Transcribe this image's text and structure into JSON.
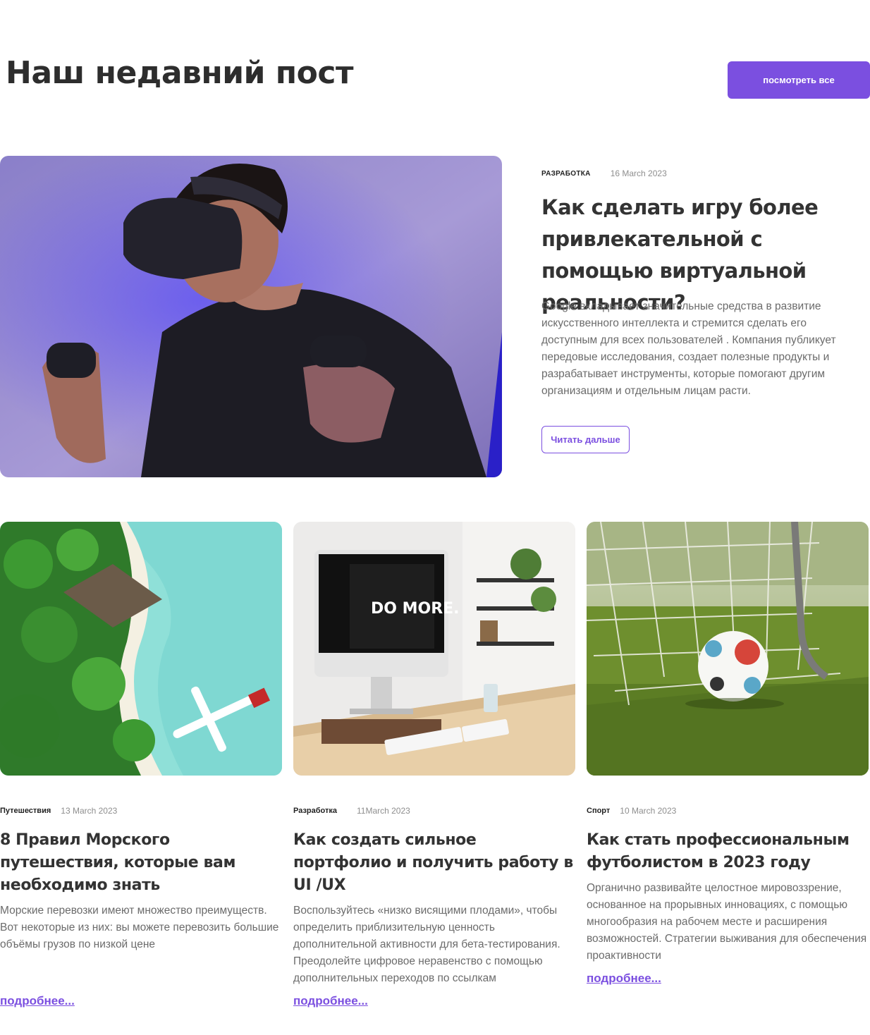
{
  "header": {
    "title": "Наш недавний пост",
    "view_all_label": "посмотреть все",
    "accent_color": "#7b4fe0"
  },
  "featured": {
    "image_icon": "vr-headset-photo",
    "category": "РАЗРАБОТКА",
    "date": "16 March 2023",
    "title": "Как сделать игру более привлекательной с помощью виртуальной реальности?",
    "text": "Google вкладывает значительные средства в развитие искусственного интеллекта и стремится сделать его доступным для всех пользователей . Компания публикует передовые исследования, создает полезные продукты и разрабатывает инструменты, которые помогают другим организациям и отдельным лицам расти.",
    "button_label": "Читать дальше"
  },
  "cards": [
    {
      "image_icon": "tropical-beach-photo",
      "category": "Путешествия",
      "date": "13 March 2023",
      "title": "8 Правил Морского путешествия, которые вам необходимо знать",
      "text": "Морские перевозки имеют множество преимуществ. Вот некоторые из них: вы можете перевозить большие объёмы грузов по низкой цене",
      "link_label": "подробнее..."
    },
    {
      "image_icon": "desk-computer-photo",
      "category": "Разработка",
      "date": "11March 2023",
      "title": "Как создать сильное портфолио и получить работу в UI /UX",
      "text": "Воспользуйтесь «низко висящими плодами», чтобы определить приблизительную ценность дополнительной активности для бета-тестирования. Преодолейте цифровое неравенство с помощью дополнительных переходов по ссылкам",
      "link_label": "подробнее...",
      "screen_text": "DO MORE."
    },
    {
      "image_icon": "soccer-ball-photo",
      "category": "Спорт",
      "date": "10 March 2023",
      "title": "Как стать профессиональным футболистом в 2023 году",
      "text": "Органично развивайте целостное мировоззрение, основанное на прорывных инновациях, с помощью многообразия на рабочем месте и расширения возможностей. Стратегии выживания для обеспечения проактивности",
      "link_label": "подробнее..."
    }
  ]
}
